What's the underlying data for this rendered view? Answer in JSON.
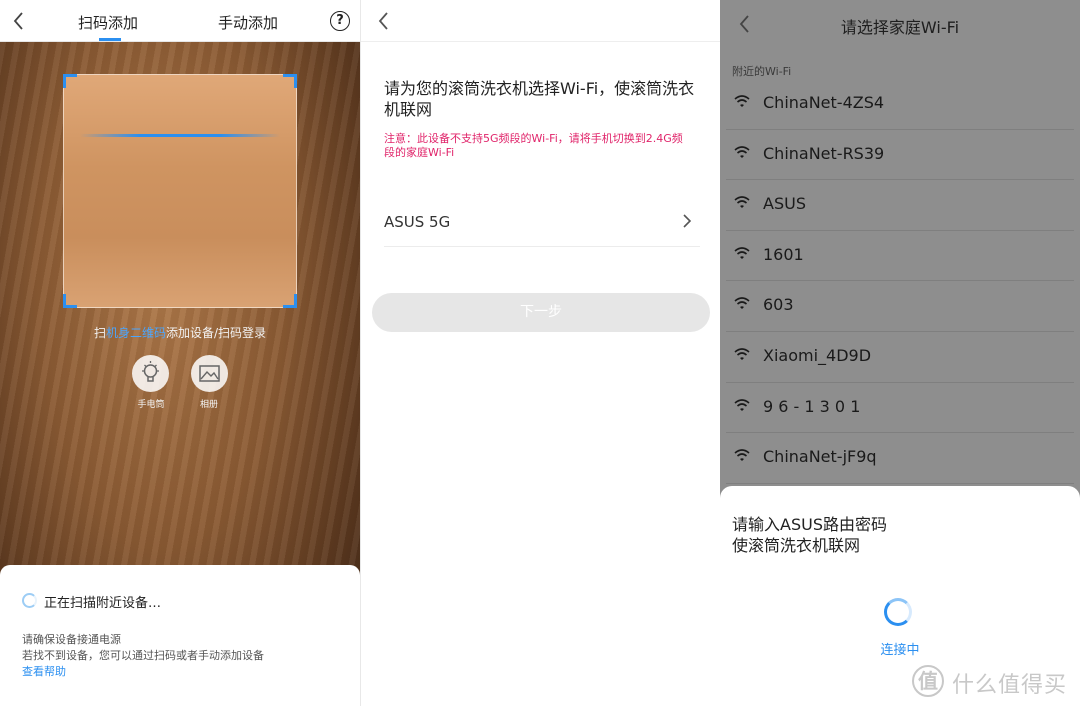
{
  "scan_screen": {
    "tabs": [
      {
        "label": "扫码添加",
        "active": true
      },
      {
        "label": "手动添加",
        "active": false
      }
    ],
    "help_icon": "?",
    "hint_prefix": "扫",
    "hint_highlight": "机身二维码",
    "hint_suffix": "添加设备/扫码登录",
    "flashlight_label": "手电筒",
    "album_label": "相册",
    "scanning_text": "正在扫描附近设备…",
    "tip_line1": "请确保设备接通电源",
    "tip_line2": "若找不到设备，您可以通过扫码或者手动添加设备",
    "help_link": "查看帮助"
  },
  "wifi_select_screen": {
    "title": "请为您的滚筒洗衣机选择Wi-Fi，使滚筒洗衣机联网",
    "note": "注意：此设备不支持5G频段的Wi-Fi，请将手机切换到2.4G频段的家庭Wi-Fi",
    "selected_wifi": "ASUS 5G",
    "next_button": "下一步"
  },
  "wifi_list_screen": {
    "title": "请选择家庭Wi-Fi",
    "section_label": "附近的Wi-Fi",
    "networks": [
      {
        "name": "ChinaNet-4ZS4"
      },
      {
        "name": "ChinaNet-RS39"
      },
      {
        "name": "ASUS"
      },
      {
        "name": "1601"
      },
      {
        "name": "603"
      },
      {
        "name": "Xiaomi_4D9D"
      },
      {
        "name": "9 6 - 1 3 0 1"
      },
      {
        "name": "ChinaNet-jF9q"
      }
    ],
    "sheet_line1": "请输入ASUS路由密码",
    "sheet_line2": "使滚筒洗衣机联网",
    "status": "连接中"
  },
  "watermark": {
    "logo_char": "值",
    "text": "什么值得买"
  },
  "colors": {
    "accent": "#2b8ff0",
    "warning": "#e0246a",
    "overlay_gray": "#8e8e8e"
  }
}
